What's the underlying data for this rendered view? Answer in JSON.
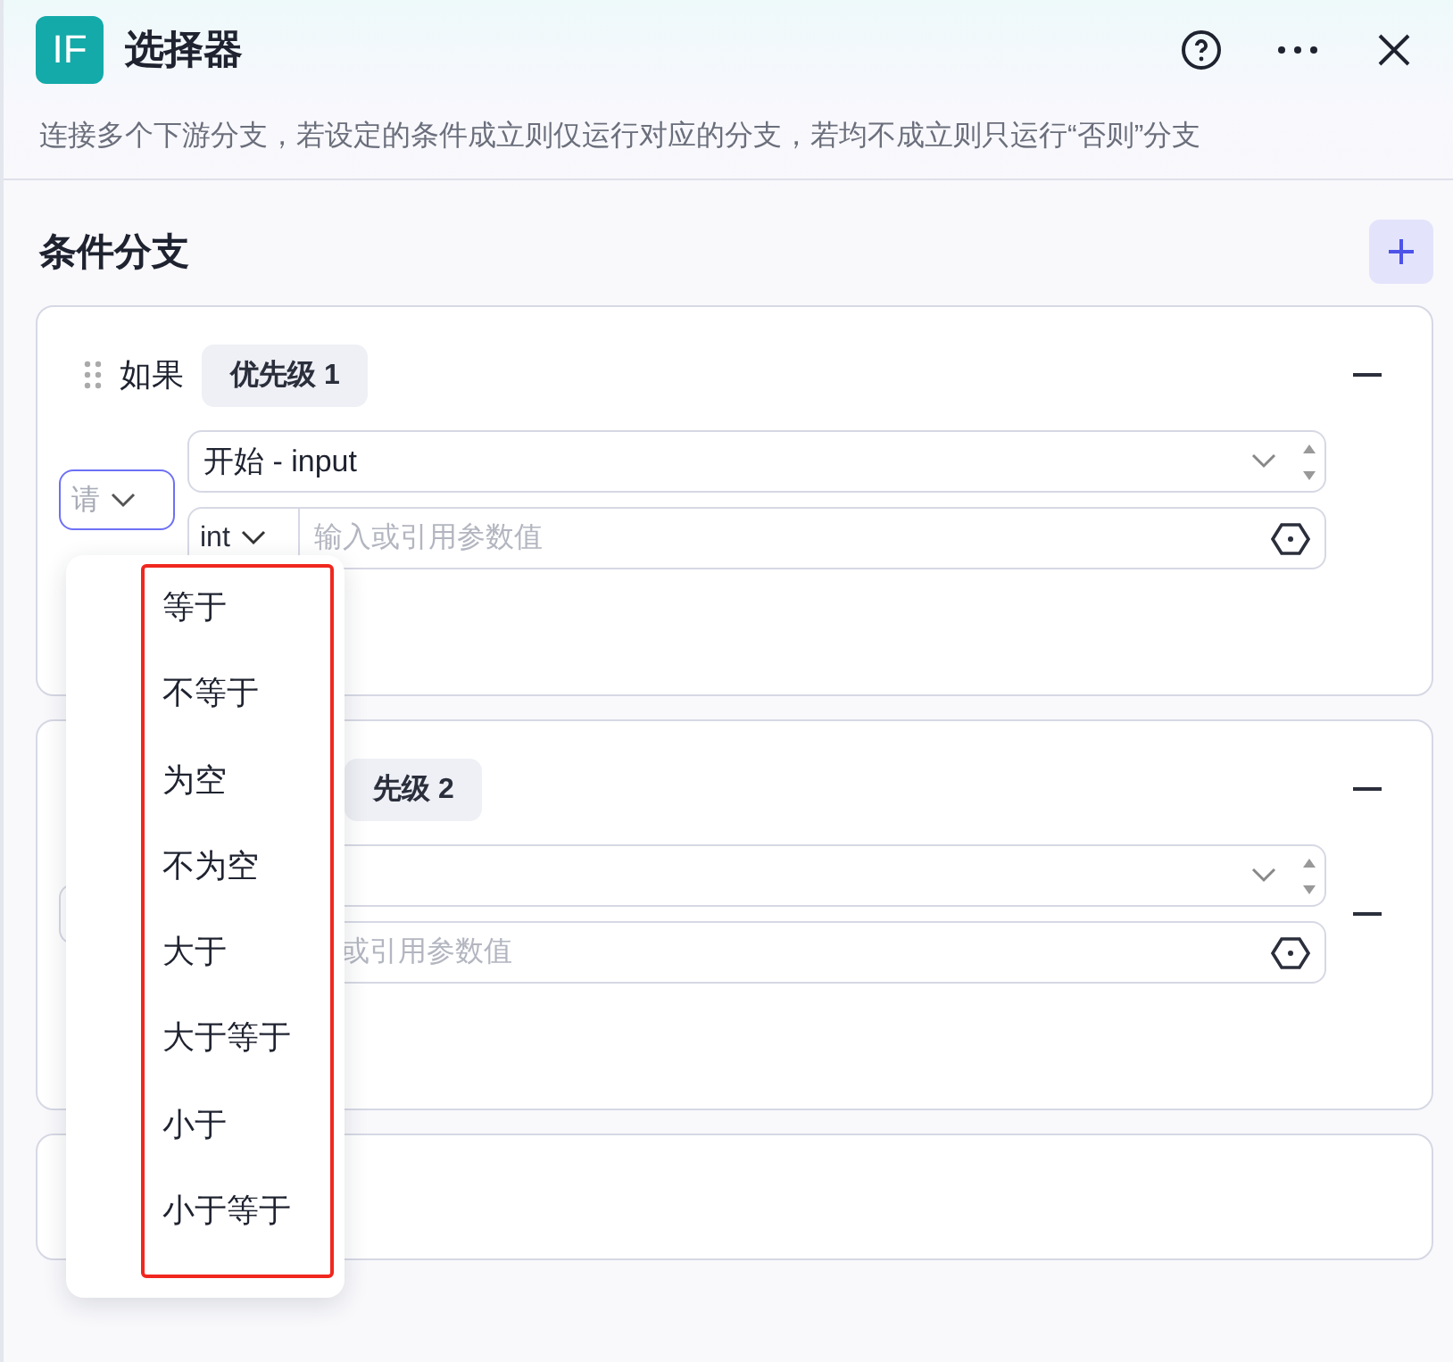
{
  "header": {
    "logo": "IF",
    "title": "选择器"
  },
  "description": "连接多个下游分支，若设定的条件成立则仅运行对应的分支，若均不成立则只运行“否则”分支",
  "section": {
    "title": "条件分支"
  },
  "branches": [
    {
      "label": "如果",
      "priority": "优先级 1",
      "conditions": [
        {
          "operator": "请",
          "field": "开始 - input",
          "type": "int",
          "value_placeholder": "输入或引用参数值",
          "removable": false
        }
      ]
    },
    {
      "priority": "先级 2",
      "conditions": [
        {
          "value_placeholder": "或引用参数值",
          "removable": true
        }
      ]
    },
    {
      "kind": "else"
    }
  ],
  "operator_menu": {
    "highlighted": true,
    "options": [
      "等于",
      "不等于",
      "为空",
      "不为空",
      "大于",
      "大于等于",
      "小于",
      "小于等于"
    ]
  }
}
